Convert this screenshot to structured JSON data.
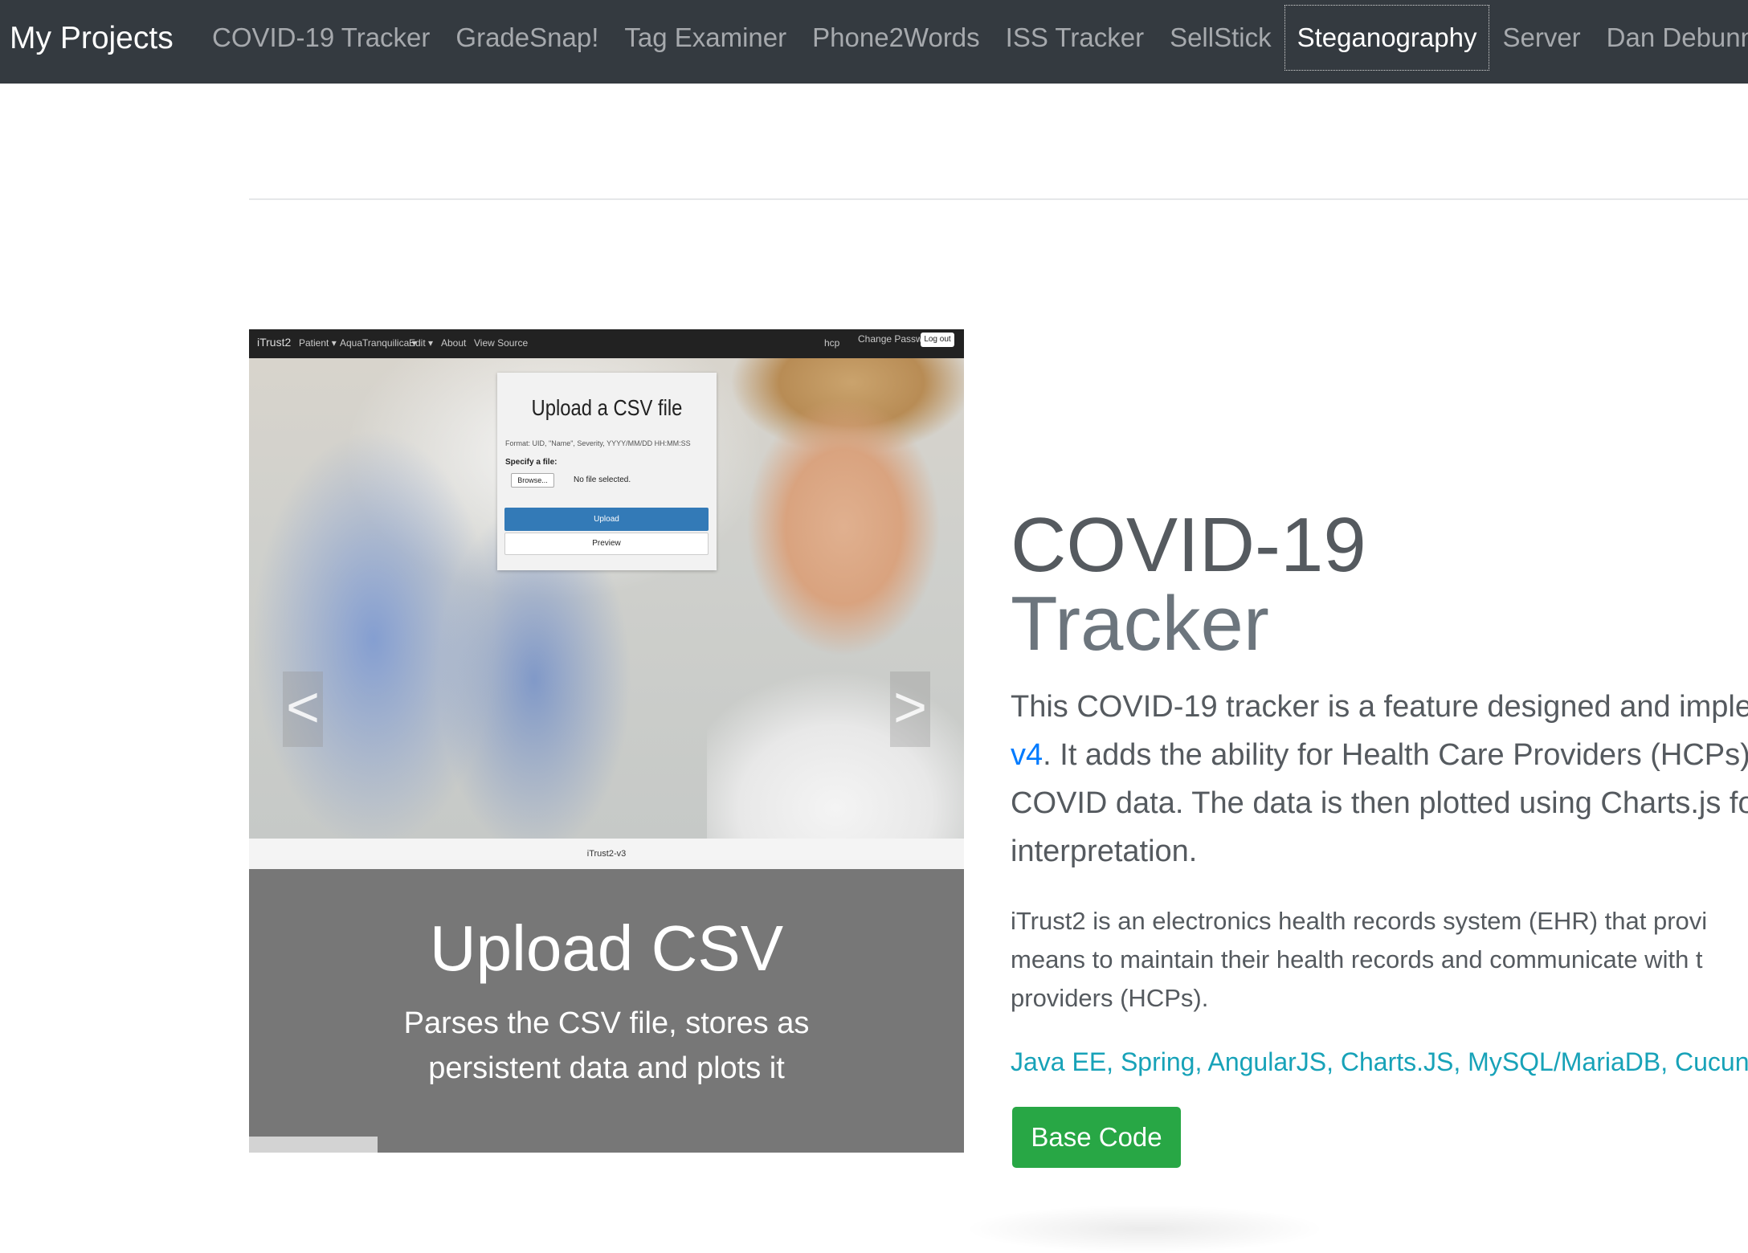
{
  "navbar": {
    "brand": "My Projects",
    "items": [
      {
        "label": "COVID-19 Tracker",
        "active": false
      },
      {
        "label": "GradeSnap!",
        "active": false
      },
      {
        "label": "Tag Examiner",
        "active": false
      },
      {
        "label": "Phone2Words",
        "active": false
      },
      {
        "label": "ISS Tracker",
        "active": false
      },
      {
        "label": "SellStick",
        "active": false
      },
      {
        "label": "Steganography",
        "active": true
      },
      {
        "label": "Server",
        "active": false
      },
      {
        "label": "Dan Debunner",
        "active": false
      }
    ]
  },
  "carousel": {
    "screenshot": {
      "nav": {
        "brand": "iTrust2",
        "items": [
          "Patient ▾",
          "AquaTranquilica ▾",
          "Edit ▾",
          "About",
          "View Source"
        ],
        "user": "hcp",
        "change_password": "Change Password",
        "logout": "Log out"
      },
      "card": {
        "title": "Upload a CSV file",
        "format": "Format: UID, \"Name\", Severity, YYYY/MM/DD HH:MM:SS",
        "specify": "Specify a file:",
        "browse": "Browse...",
        "no_file": "No file selected.",
        "upload": "Upload",
        "preview": "Preview"
      },
      "caption": "iTrust2-v3"
    },
    "prev_icon": "chevron-left-icon",
    "next_icon": "chevron-right-icon",
    "prev_glyph": "<",
    "next_glyph": ">",
    "caption_title": "Upload CSV",
    "caption_text": "Parses the CSV file, stores as persistent data and plots it",
    "progress": 0.18
  },
  "project": {
    "title_line1": "COVID-19",
    "title_line2": "Tracker",
    "lead_line1": "This COVID-19 tracker is a feature designed and imple",
    "lead_link": "v4",
    "lead_line2_rest": ". It adds the ability for Health Care Providers (HCPs)",
    "lead_line3": "COVID data. The data is then plotted using Charts.js fo",
    "lead_line4": "interpretation.",
    "desc_line1": "iTrust2 is an electronics health records system (EHR) that provi",
    "desc_line2": "means to maintain their health records and communicate with t",
    "desc_line3": "providers (HCPs).",
    "tech": "Java EE, Spring, AngularJS, Charts.JS, MySQL/MariaDB, Cucun",
    "button_label": "Base Code"
  },
  "colors": {
    "navbar_bg": "#343a40",
    "button_green": "#28a745",
    "link_blue": "#007bff",
    "tech_teal": "#17a2b8",
    "caption_bg": "#777777"
  }
}
